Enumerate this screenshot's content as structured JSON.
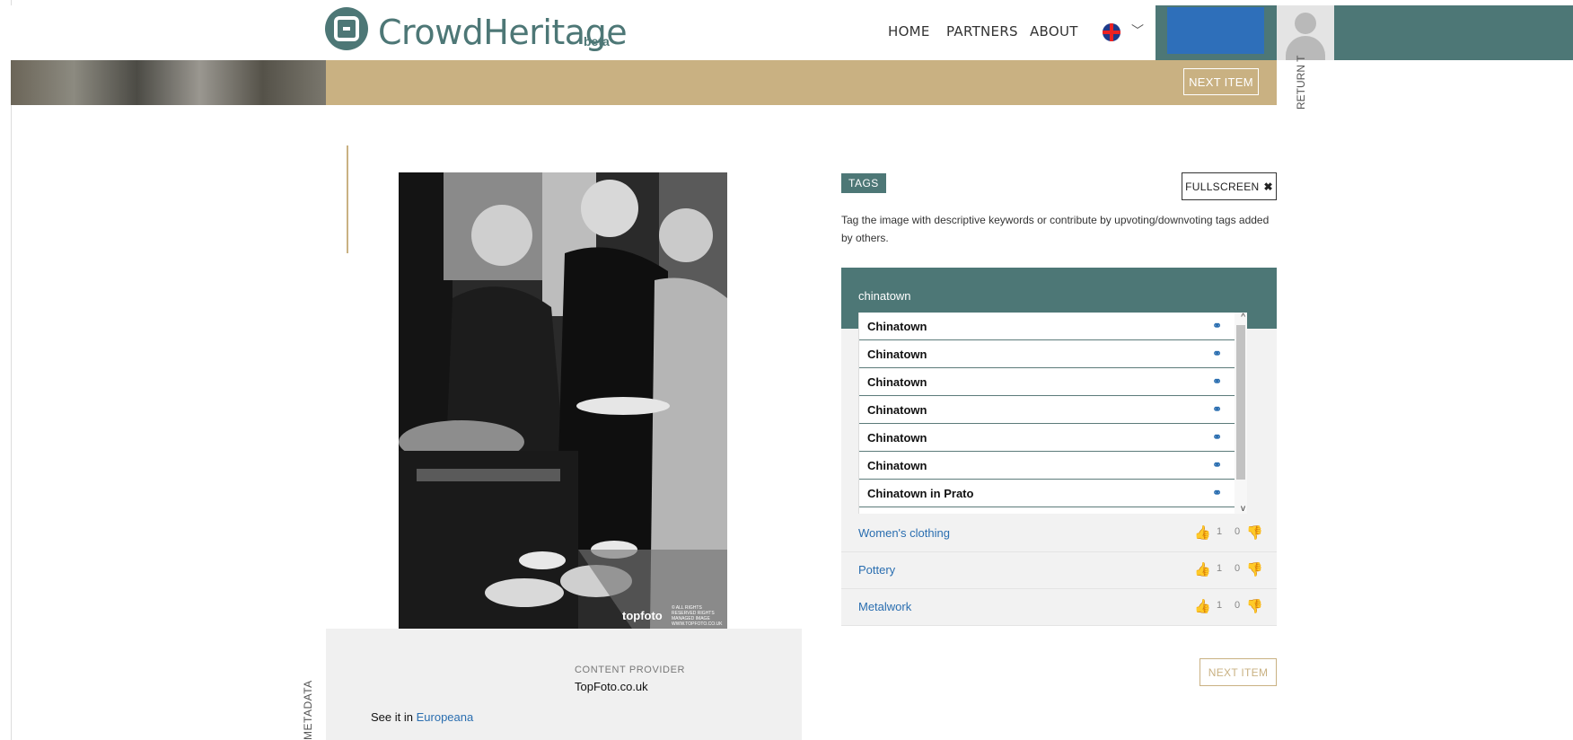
{
  "header": {
    "logo_text": "CrowdHeritage",
    "logo_beta": "beta",
    "nav": [
      "HOME",
      "PARTNERS",
      "ABOUT"
    ],
    "language_icon": "uk-flag-icon",
    "dropdown_icon": "chevron-down-icon"
  },
  "banner": {
    "next_item_label": "NEXT ITEM",
    "return_label": "RETURN T"
  },
  "image": {
    "watermark": "topfoto",
    "watermark_small": "© ALL RIGHTS RESERVED RIGHTS MANAGED IMAGE WWW.TOPFOTO.CO.UK"
  },
  "metadata": {
    "vertical_label": "METADATA",
    "content_provider_label": "CONTENT PROVIDER",
    "content_provider_value": "TopFoto.co.uk",
    "see_it_prefix": "See it in",
    "see_it_link": "Europeana"
  },
  "tags": {
    "badge": "TAGS",
    "fullscreen_label": "FULLSCREEN",
    "fullscreen_icon": "expand-icon",
    "instructions": "Tag the image with descriptive keywords or contribute by upvoting/downvoting tags added by others.",
    "input_value": "chinatown",
    "suggestions": [
      "Chinatown",
      "Chinatown",
      "Chinatown",
      "Chinatown",
      "Chinatown",
      "Chinatown",
      "Chinatown in Prato"
    ],
    "list": [
      {
        "name": "Women's clothing",
        "up": "1",
        "down": "0"
      },
      {
        "name": "Pottery",
        "up": "1",
        "down": "0"
      },
      {
        "name": "Metalwork",
        "up": "1",
        "down": "0"
      }
    ],
    "next_item_label": "NEXT ITEM"
  },
  "colors": {
    "teal": "#4d7776",
    "tan": "#c9b182",
    "link_blue": "#2a6eb0",
    "header_blue": "#2e6fba"
  }
}
